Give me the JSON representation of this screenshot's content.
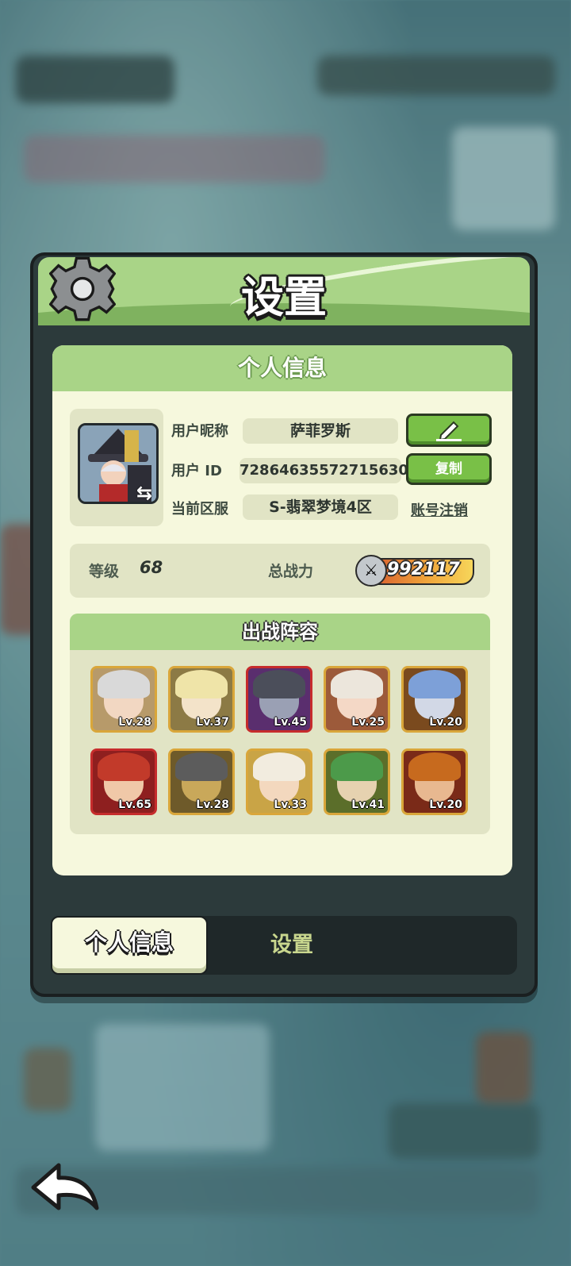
{
  "header": {
    "title": "设置"
  },
  "profile": {
    "section_title": "个人信息",
    "nickname_label": "用户昵称",
    "nickname_value": "萨菲罗斯",
    "uid_label": "用户  ID",
    "uid_value": "72864635572715630",
    "copy_button": "复制",
    "server_label": "当前区服",
    "server_value": "S-翡翠梦境4区",
    "logout_link": "账号注销"
  },
  "stats": {
    "level_label": "等级",
    "level_value": "68",
    "power_label": "总战力",
    "power_value": "992117"
  },
  "lineup": {
    "title": "出战阵容",
    "heroes": [
      {
        "level": "Lv.28",
        "hair": "#d9d9d9",
        "face": "#f2d7c2",
        "bg": "#b79a6a",
        "border": "gold"
      },
      {
        "level": "Lv.37",
        "hair": "#efe4a8",
        "face": "#f3e3c9",
        "bg": "#8c7a45",
        "border": "gold"
      },
      {
        "level": "Lv.45",
        "hair": "#4b4e5a",
        "face": "#9aa0b4",
        "bg": "#5a2e6e",
        "border": "red"
      },
      {
        "level": "Lv.25",
        "hair": "#ece6dc",
        "face": "#f4d8c6",
        "bg": "#9c5a3a",
        "border": "gold"
      },
      {
        "level": "Lv.20",
        "hair": "#7da0d8",
        "face": "#d2d8e6",
        "bg": "#7a4a1e",
        "border": "gold"
      },
      {
        "level": "Lv.65",
        "hair": "#c23a2a",
        "face": "#f0c8a8",
        "bg": "#8e1f1f",
        "border": "red"
      },
      {
        "level": "Lv.28",
        "hair": "#5c5c5c",
        "face": "#c9a85a",
        "bg": "#6e5a2a",
        "border": "gold"
      },
      {
        "level": "Lv.33",
        "hair": "#f2ecdf",
        "face": "#f3d8be",
        "bg": "#c9a446",
        "border": "gold"
      },
      {
        "level": "Lv.41",
        "hair": "#4c9a4a",
        "face": "#e6d2b0",
        "bg": "#5b6e2a",
        "border": "gold"
      },
      {
        "level": "Lv.20",
        "hair": "#c76a1e",
        "face": "#e8b890",
        "bg": "#7a2a18",
        "border": "gold"
      }
    ]
  },
  "tabs": {
    "active": "个人信息",
    "inactive": "设置"
  },
  "colors": {
    "panel_green": "#a9d487",
    "card_bg": "#f6f8dd",
    "button_green": "#79c047"
  },
  "icons": [
    "gear-icon",
    "edit-pencil-icon",
    "swap-avatar-icon",
    "sword-power-icon",
    "back-arrow-icon"
  ]
}
